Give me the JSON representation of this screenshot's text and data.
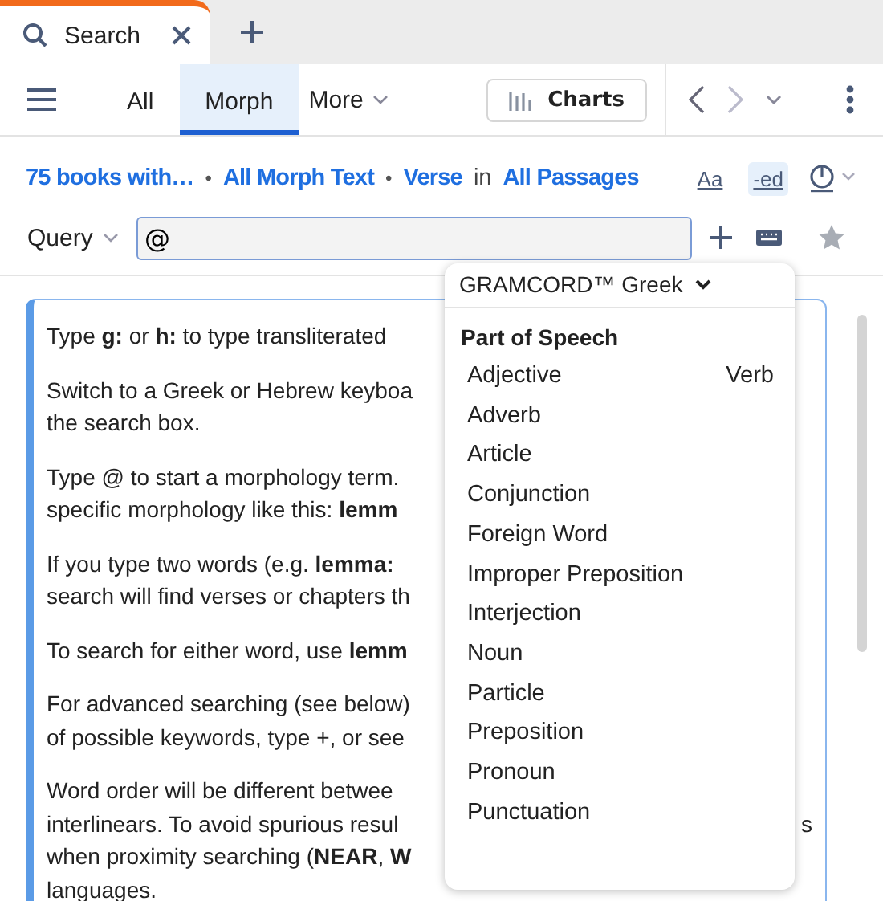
{
  "tabs": [
    {
      "label": "Search",
      "selected": true
    }
  ],
  "toolbar": {
    "tabs": [
      {
        "label": "All",
        "selected": false
      },
      {
        "label": "Morph",
        "selected": true
      }
    ],
    "more": "More",
    "charts": "Charts"
  },
  "scope": [
    {
      "kind": "link",
      "text": "75 books with…"
    },
    {
      "kind": "dot",
      "text": "•"
    },
    {
      "kind": "link",
      "text": "All Morph Text"
    },
    {
      "kind": "dot",
      "text": "•"
    },
    {
      "kind": "link",
      "text": "Verse"
    },
    {
      "kind": "plain",
      "text": "in"
    },
    {
      "kind": "link",
      "text": "All Passages"
    }
  ],
  "scope_icons": {
    "case": "Aa",
    "ed": "-ed",
    "ed_on": true
  },
  "query": {
    "label": "Query",
    "value": "@"
  },
  "help": [
    [
      "Type **g:** or **h:** to type transliterated"
    ],
    [
      "Switch to a Greek or Hebrew keyboa",
      "the search box."
    ],
    [
      "Type @ to start a morphology term.",
      "specific morphology like this: **lemm**"
    ],
    [
      "If you type two words (e.g. **lemma:**",
      "search will find verses or chapters th"
    ],
    [
      "To search for either word, use **lemm**"
    ],
    [
      "For advanced searching (see below)",
      "of possible keywords, type +, or see"
    ],
    [
      "Word order will be different betwee",
      "interlinears. To avoid spurious resul",
      "when proximity searching (**NEAR**, **W**",
      "languages."
    ]
  ],
  "help_tail": "s",
  "popup": {
    "source": "GRAMCORD™ Greek",
    "heading": "Part of Speech",
    "items": [
      "Adjective",
      "Adverb",
      "Article",
      "Conjunction",
      "Foreign Word",
      "Improper Preposition",
      "Interjection",
      "Noun",
      "Particle",
      "Preposition",
      "Pronoun",
      "Punctuation"
    ],
    "column_2": [
      "Verb"
    ]
  }
}
